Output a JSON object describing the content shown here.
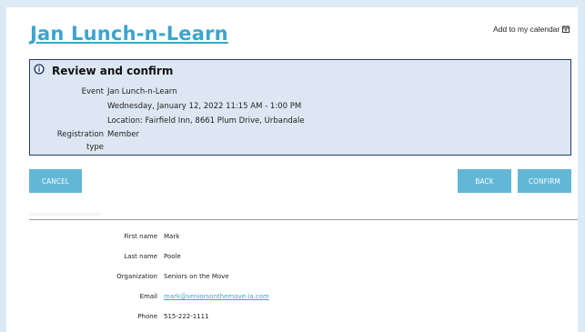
{
  "event_title": "Jan Lunch-n-Learn",
  "calendar_link": "Add to my calendar",
  "review": {
    "heading": "Review and confirm",
    "event_label": "Event",
    "event_name": "Jan Lunch-n-Learn",
    "event_datetime": "Wednesday, January 12, 2022 11:15 AM - 1:00 PM",
    "event_location": "Location: Fairfield Inn, 8661 Plum Drive, Urbandale",
    "registration_label_line1": "Registration",
    "registration_label_line2": "type",
    "registration_value": "Member"
  },
  "buttons": {
    "cancel": "CANCEL",
    "back": "BACK",
    "confirm": "CONFIRM"
  },
  "fields": {
    "first_name_label": "First name",
    "first_name": "Mark",
    "last_name_label": "Last name",
    "last_name": "Poole",
    "organization_label": "Organization",
    "organization": "Seniors on the Move",
    "email_label": "Email",
    "email": "mark@seniorsonthemove-ia.com",
    "phone_label": "Phone",
    "phone": "515-222-1111"
  },
  "colors": {
    "accent": "#3ba5cf",
    "button": "#63b7d6",
    "review_bg": "#dde7f3",
    "review_border": "#1f3c68"
  }
}
